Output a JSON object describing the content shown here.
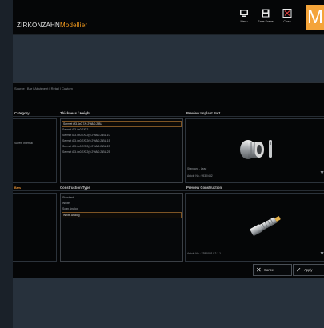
{
  "app": {
    "brand": "ZIRKONZAHN",
    "product": "Modellier",
    "badge_letter": "M"
  },
  "toolbar": {
    "buttons": [
      {
        "label": "Menu",
        "icon": "monitor-icon"
      },
      {
        "label": "Save Scene",
        "icon": "floppy-disk-icon"
      },
      {
        "label": "Close",
        "icon": "close-icon"
      }
    ]
  },
  "breadcrumb": "Source | Bar | Abutment | Retail | Custom",
  "columns": {
    "category": "Category",
    "thickness": "Thickness / Height",
    "preview_implant": "Preview Implant Part",
    "construction": "Construction Type",
    "preview_construction": "Preview Construction"
  },
  "categories": {
    "item_1": "Screw Internal",
    "item_2_active": "Bars"
  },
  "thickness_items": [
    "Sermet Ø3.4x0.7/0.2%8/0.2 BL",
    "Sermet Ø3.4x0.7/0.2",
    "Sermet Ø3.4x0.7/0.2(0.2%8/0.2)BL.10",
    "Sermet Ø3.4x0.7/0.2(0.2%8/0.2)BL.15",
    "Sermet Ø3.4x0.7/0.2(0.2%8/0.2)BL.20",
    "Sermet Ø3.4x0.7/0.2(0.2%8/0.2)BL.25"
  ],
  "construction_items": [
    "Standard",
    "White",
    "Scan Analog",
    "White Analog"
  ],
  "implant_meta": {
    "standard": "Standard - Lead",
    "article": "Article No.: 9530/432"
  },
  "construction_meta": {
    "article": "Article No.: 2280/001/12.1.1"
  },
  "actions": {
    "cancel": "Cancel",
    "apply": "Apply"
  },
  "colors": {
    "accent": "#f39a1e",
    "badge": "#f4a43a",
    "panel": "#050607",
    "window_bg": "#27313c"
  }
}
